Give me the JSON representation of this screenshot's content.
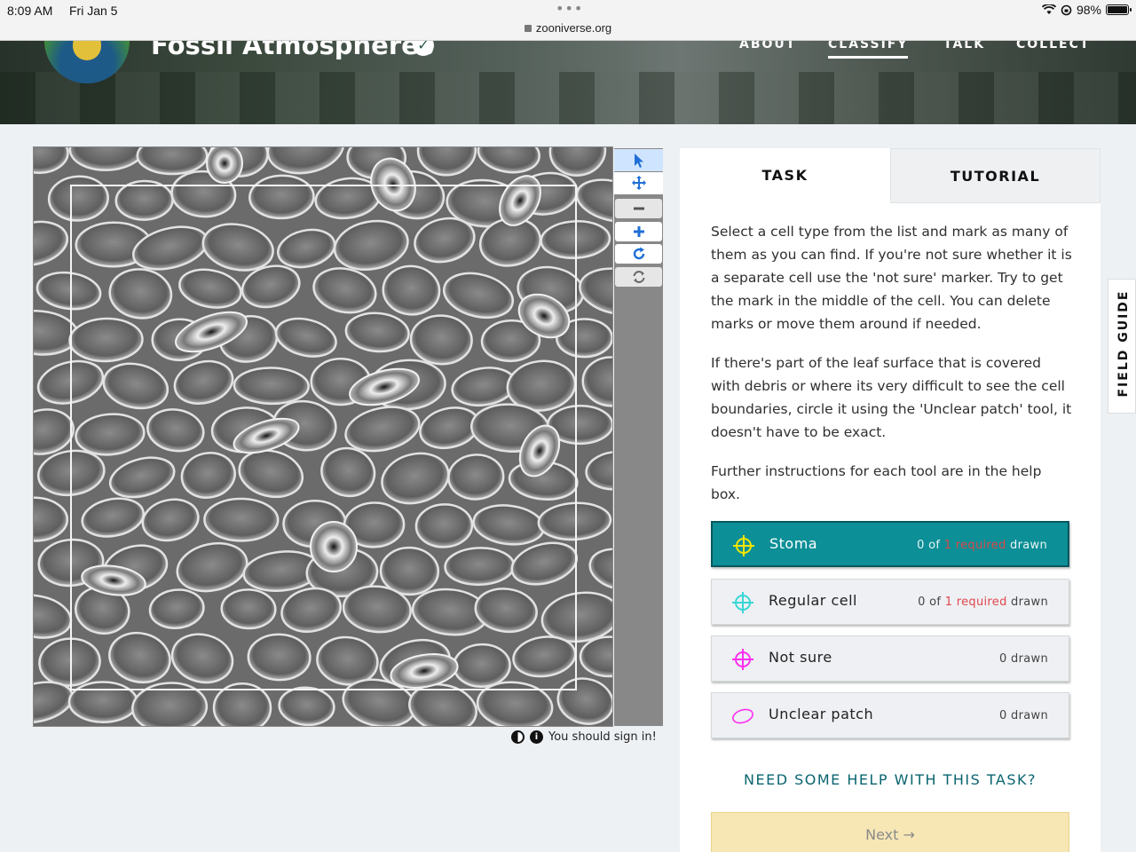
{
  "status_bar": {
    "time": "8:09 AM",
    "date": "Fri Jan 5",
    "url": "zooniverse.org",
    "battery": "98%",
    "battery_level": 0.98
  },
  "header": {
    "project_title": "Fossil Atmospheres",
    "nav": [
      "ABOUT",
      "CLASSIFY",
      "TALK",
      "COLLECT"
    ],
    "active_nav": "CLASSIFY"
  },
  "viewer": {
    "tools": [
      "pointer-icon",
      "move-icon",
      "zoom-out-icon",
      "zoom-in-icon",
      "rotate-icon",
      "reset-icon"
    ],
    "sign_in_text": "You should sign in!"
  },
  "task_panel": {
    "tabs": [
      "TASK",
      "TUTORIAL"
    ],
    "active_tab": "TASK",
    "instructions": [
      "Select a cell type from the list and mark as many of them as you can find. If you're not sure whether it is a separate cell use the 'not sure' marker. Try to get the mark in the middle of the cell. You can delete marks or move them around if needed.",
      "If there's part of the leaf surface that is covered with debris or where its very difficult to see the cell boundaries, circle it using the 'Unclear patch' tool, it doesn't have to be exact.",
      "Further instructions for each tool are in the help box."
    ],
    "tools": [
      {
        "label": "Stoma",
        "count_prefix": "0 of ",
        "required": "1 required",
        "count_suffix": " drawn",
        "color": "#f3e600",
        "icon": "crosshair-icon"
      },
      {
        "label": "Regular cell",
        "count_prefix": "0 of ",
        "required": "1 required",
        "count_suffix": " drawn",
        "color": "#39d6d6",
        "icon": "crosshair-icon"
      },
      {
        "label": "Not sure",
        "count_prefix": "",
        "required": "",
        "count_suffix": "0 drawn",
        "color": "#ff2ff0",
        "icon": "crosshair-icon"
      },
      {
        "label": "Unclear patch",
        "count_prefix": "",
        "required": "",
        "count_suffix": "0 drawn",
        "color": "#ff2ff0",
        "icon": "ellipse-icon"
      }
    ],
    "help_link": "NEED SOME HELP WITH THIS TASK?",
    "next_label": "Next →"
  },
  "field_guide": "FIELD GUIDE",
  "colors": {
    "accent": "#0c8f97",
    "required": "#e0474e",
    "next_bg": "#f6e7b5"
  }
}
